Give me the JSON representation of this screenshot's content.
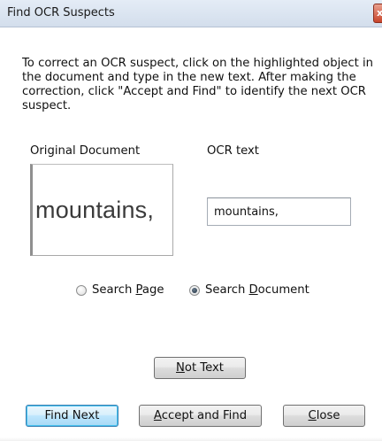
{
  "window": {
    "title": "Find OCR Suspects",
    "close_glyph": "x"
  },
  "instructions": "To correct an OCR suspect, click on the highlighted object in the document and type in the new text. After making the correction, click \"Accept and Find\" to identify the next OCR suspect.",
  "original_document": {
    "label": "Original Document",
    "image_text": "mountains,"
  },
  "ocr_text": {
    "label": "OCR text",
    "value": "mountains,"
  },
  "search_scope": {
    "options": [
      {
        "pre": "Search ",
        "mnemonic": "P",
        "post": "age",
        "checked": false
      },
      {
        "pre": "Search ",
        "mnemonic": "D",
        "post": "ocument",
        "checked": true
      }
    ]
  },
  "buttons": {
    "not_text": {
      "mnemonic": "N",
      "post": "ot Text"
    },
    "find_next": {
      "label": "Find Next"
    },
    "accept_and_find": {
      "mnemonic": "A",
      "post": "ccept and Find"
    },
    "close": {
      "mnemonic": "C",
      "post": "lose"
    }
  }
}
